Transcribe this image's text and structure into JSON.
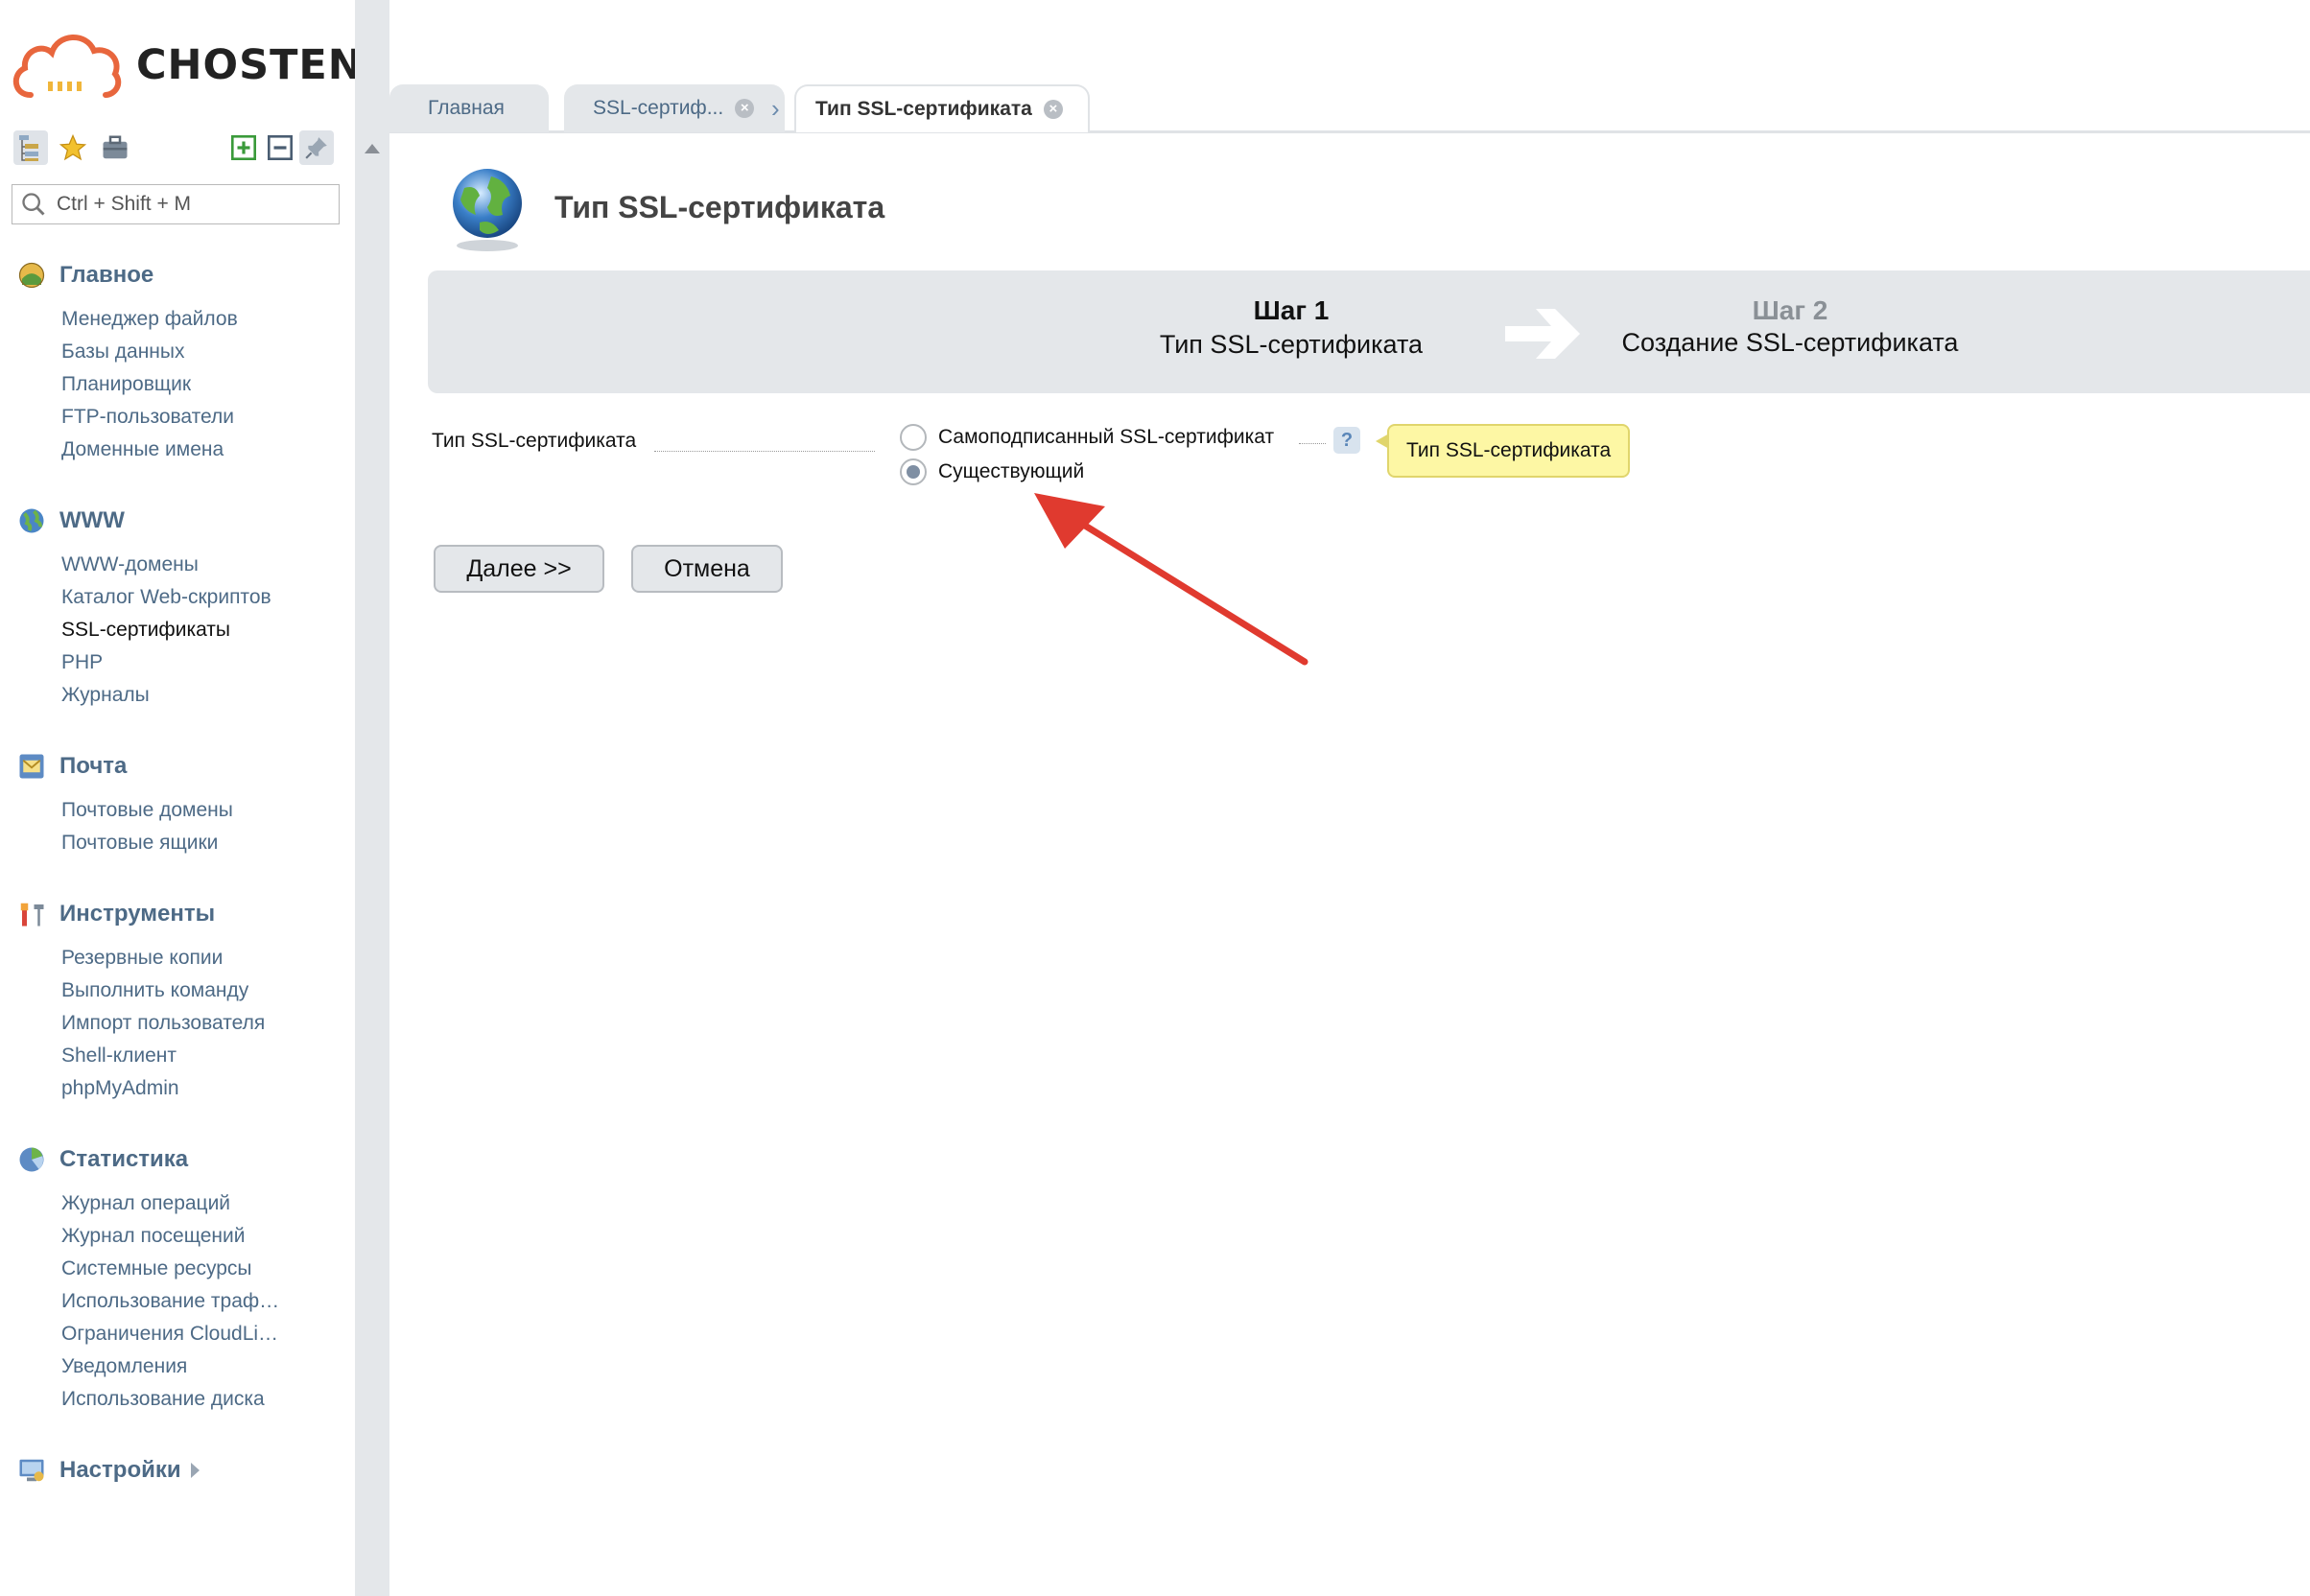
{
  "brand": {
    "name": "CHOSTEN",
    "accent": "#e8663d"
  },
  "search": {
    "placeholder": "Ctrl + Shift + M"
  },
  "toolbar": [
    "tree-icon",
    "star-icon",
    "briefcase-icon",
    "expand-icon",
    "collapse-icon",
    "pin-icon"
  ],
  "sidebar": {
    "groups": [
      {
        "title": "Главное",
        "icon": "home-icon",
        "items": [
          "Менеджер файлов",
          "Базы данных",
          "Планировщик",
          "FTP-пользователи",
          "Доменные имена"
        ]
      },
      {
        "title": "WWW",
        "icon": "globe-icon",
        "items": [
          "WWW-домены",
          "Каталог Web-скриптов",
          "SSL-сертификаты",
          "PHP",
          "Журналы"
        ]
      },
      {
        "title": "Почта",
        "icon": "mail-icon",
        "items": [
          "Почтовые домены",
          "Почтовые ящики"
        ]
      },
      {
        "title": "Инструменты",
        "icon": "tools-icon",
        "items": [
          "Резервные копии",
          "Выполнить команду",
          "Импорт пользователя",
          "Shell-клиент",
          "phpMyAdmin"
        ]
      },
      {
        "title": "Статистика",
        "icon": "chart-icon",
        "items": [
          "Журнал операций",
          "Журнал посещений",
          "Системные ресурсы",
          "Использование траф…",
          "Ограничения CloudLi…",
          "Уведомления",
          "Использование диска"
        ]
      },
      {
        "title": "Настройки",
        "icon": "settings-icon",
        "items": []
      }
    ]
  },
  "tabs": [
    {
      "label": "Главная"
    },
    {
      "label": "SSL-сертиф..."
    },
    {
      "label": "Тип SSL-сертификата"
    }
  ],
  "page": {
    "title": "Тип SSL-сертификата"
  },
  "steps": [
    {
      "number": "Шаг 1",
      "label": "Тип SSL-сертификата"
    },
    {
      "number": "Шаг 2",
      "label": "Создание SSL-сертификата"
    }
  ],
  "form": {
    "label": "Тип SSL-сертификата",
    "options": [
      {
        "label": "Самоподписанный SSL-сертификат",
        "selected": false
      },
      {
        "label": "Существующий",
        "selected": true
      }
    ],
    "help": "?",
    "tooltip": "Тип SSL-сертификата"
  },
  "buttons": {
    "next": "Далее >>",
    "cancel": "Отмена"
  }
}
